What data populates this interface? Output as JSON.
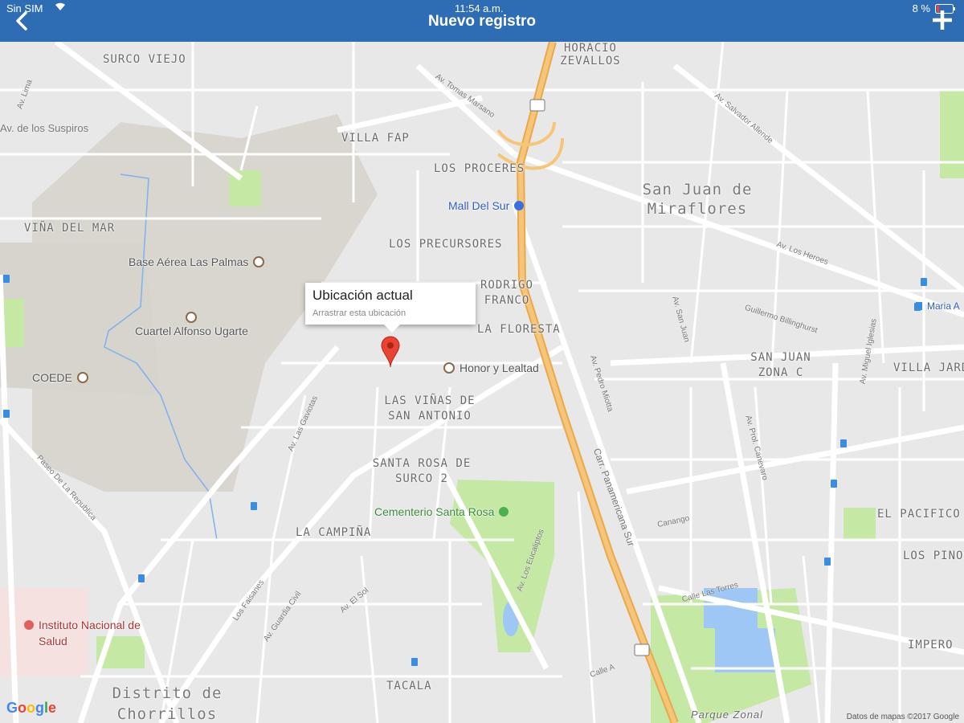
{
  "status_bar": {
    "carrier": "Sin SIM",
    "time": "11:54 a.m.",
    "battery": "8 %"
  },
  "header": {
    "title": "Nuevo registro"
  },
  "map": {
    "info_window": {
      "title": "Ubicación actual",
      "subtitle": "Arrastrar esta ubicación"
    },
    "areas": [
      "SURCO VIEJO",
      "HORACIO ZEVALLOS",
      "VILLA FAP",
      "LOS PROCERES",
      "San Juan de Miraflores",
      "VIÑA DEL MAR",
      "LOS PRECURSORES",
      "RODRIGO FRANCO",
      "LA FLORESTA",
      "SAN JUAN ZONA C",
      "VILLA JARDÍN",
      "LAS VIÑAS DE SAN ANTONIO",
      "SANTA ROSA DE SURCO 2",
      "LA CAMPIÑA",
      "EL PACIFICO",
      "LOS PINOS",
      "IMPERO",
      "TACALA",
      "Distrito de Chorrillos",
      "Parque Zonal"
    ],
    "pois": [
      "Mall Del Sur",
      "Base Aérea Las Palmas",
      "Cuartel Alfonso Ugarte",
      "COEDE",
      "Honor y Lealtad",
      "Cementerio Santa Rosa",
      "Instituto Nacional de Salud",
      "Maria A"
    ],
    "streets": [
      "Av. Tomas Marsano",
      "Av. Salvador Allende",
      "Av. Los Heroes",
      "Guillermo Billinghurst",
      "Av. Pedro Miotta",
      "Carr. Panamericana Sur",
      "Av. Los Eucaliptos",
      "Av. El Sol",
      "Av. Guardia Civil",
      "Av. Las Gaviotas",
      "Paseo De La Republica",
      "Calle Las Torres",
      "Calle A",
      "Av. San Juan",
      "Los Faisanes",
      "Canango",
      "Av. Miguel Iglesias",
      "Av. Prol. Canevaro",
      "Av. Lima",
      "Av. de los Suspiros"
    ],
    "highway_shields": [
      "1S",
      "1S"
    ],
    "logo": "Google",
    "copyright": "Datos de mapas ©2017 Google"
  },
  "colors": {
    "header": "#2e6db4",
    "highway": "#f2b55a",
    "park": "#c5e8a5",
    "marker": "#ea4335",
    "water": "#9ec7f5"
  }
}
